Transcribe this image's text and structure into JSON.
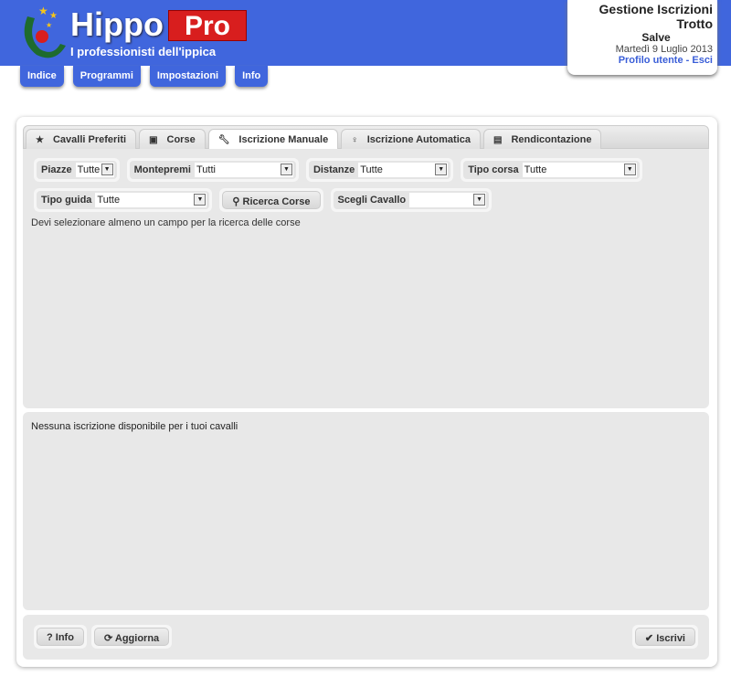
{
  "header": {
    "brand": "Hippo",
    "brand_badge": "Pro",
    "tagline": "I professionisti dell'ippica"
  },
  "nav": [
    {
      "label": "Indice"
    },
    {
      "label": "Programmi"
    },
    {
      "label": "Impostazioni"
    },
    {
      "label": "Info"
    }
  ],
  "user_box": {
    "title": "Gestione Iscrizioni Trotto",
    "greeting": "Salve",
    "date": "Martedì 9 Luglio 2013",
    "profile_link": "Profilo utente",
    "separator": " - ",
    "logout_link": "Esci"
  },
  "tabs": [
    {
      "label": "Cavalli Preferiti",
      "icon": "star-icon"
    },
    {
      "label": "Corse",
      "icon": "calendar-icon"
    },
    {
      "label": "Iscrizione Manuale",
      "icon": "wrench-icon",
      "active": true
    },
    {
      "label": "Iscrizione Automatica",
      "icon": "lightbulb-icon"
    },
    {
      "label": "Rendicontazione",
      "icon": "list-icon"
    }
  ],
  "filters": {
    "piazze": {
      "label": "Piazze",
      "value": "Tutte"
    },
    "montepremi": {
      "label": "Montepremi",
      "value": "Tutti"
    },
    "distanze": {
      "label": "Distanze",
      "value": "Tutte"
    },
    "tipo_corsa": {
      "label": "Tipo corsa",
      "value": "Tutte"
    },
    "tipo_guida": {
      "label": "Tipo guida",
      "value": "Tutte"
    },
    "search_button": "Ricerca Corse",
    "cavallo": {
      "label": "Scegli Cavallo",
      "value": ""
    }
  },
  "search_message": "Devi selezionare almeno un campo per la ricerca delle corse",
  "entries_message": "Nessuna iscrizione disponibile per i tuoi cavalli",
  "footer": {
    "info": "Info",
    "refresh": "Aggiorna",
    "submit": "Iscrivi"
  },
  "colors": {
    "header": "#4066dd",
    "badge": "#d81e1e",
    "link": "#3a5ed8"
  }
}
